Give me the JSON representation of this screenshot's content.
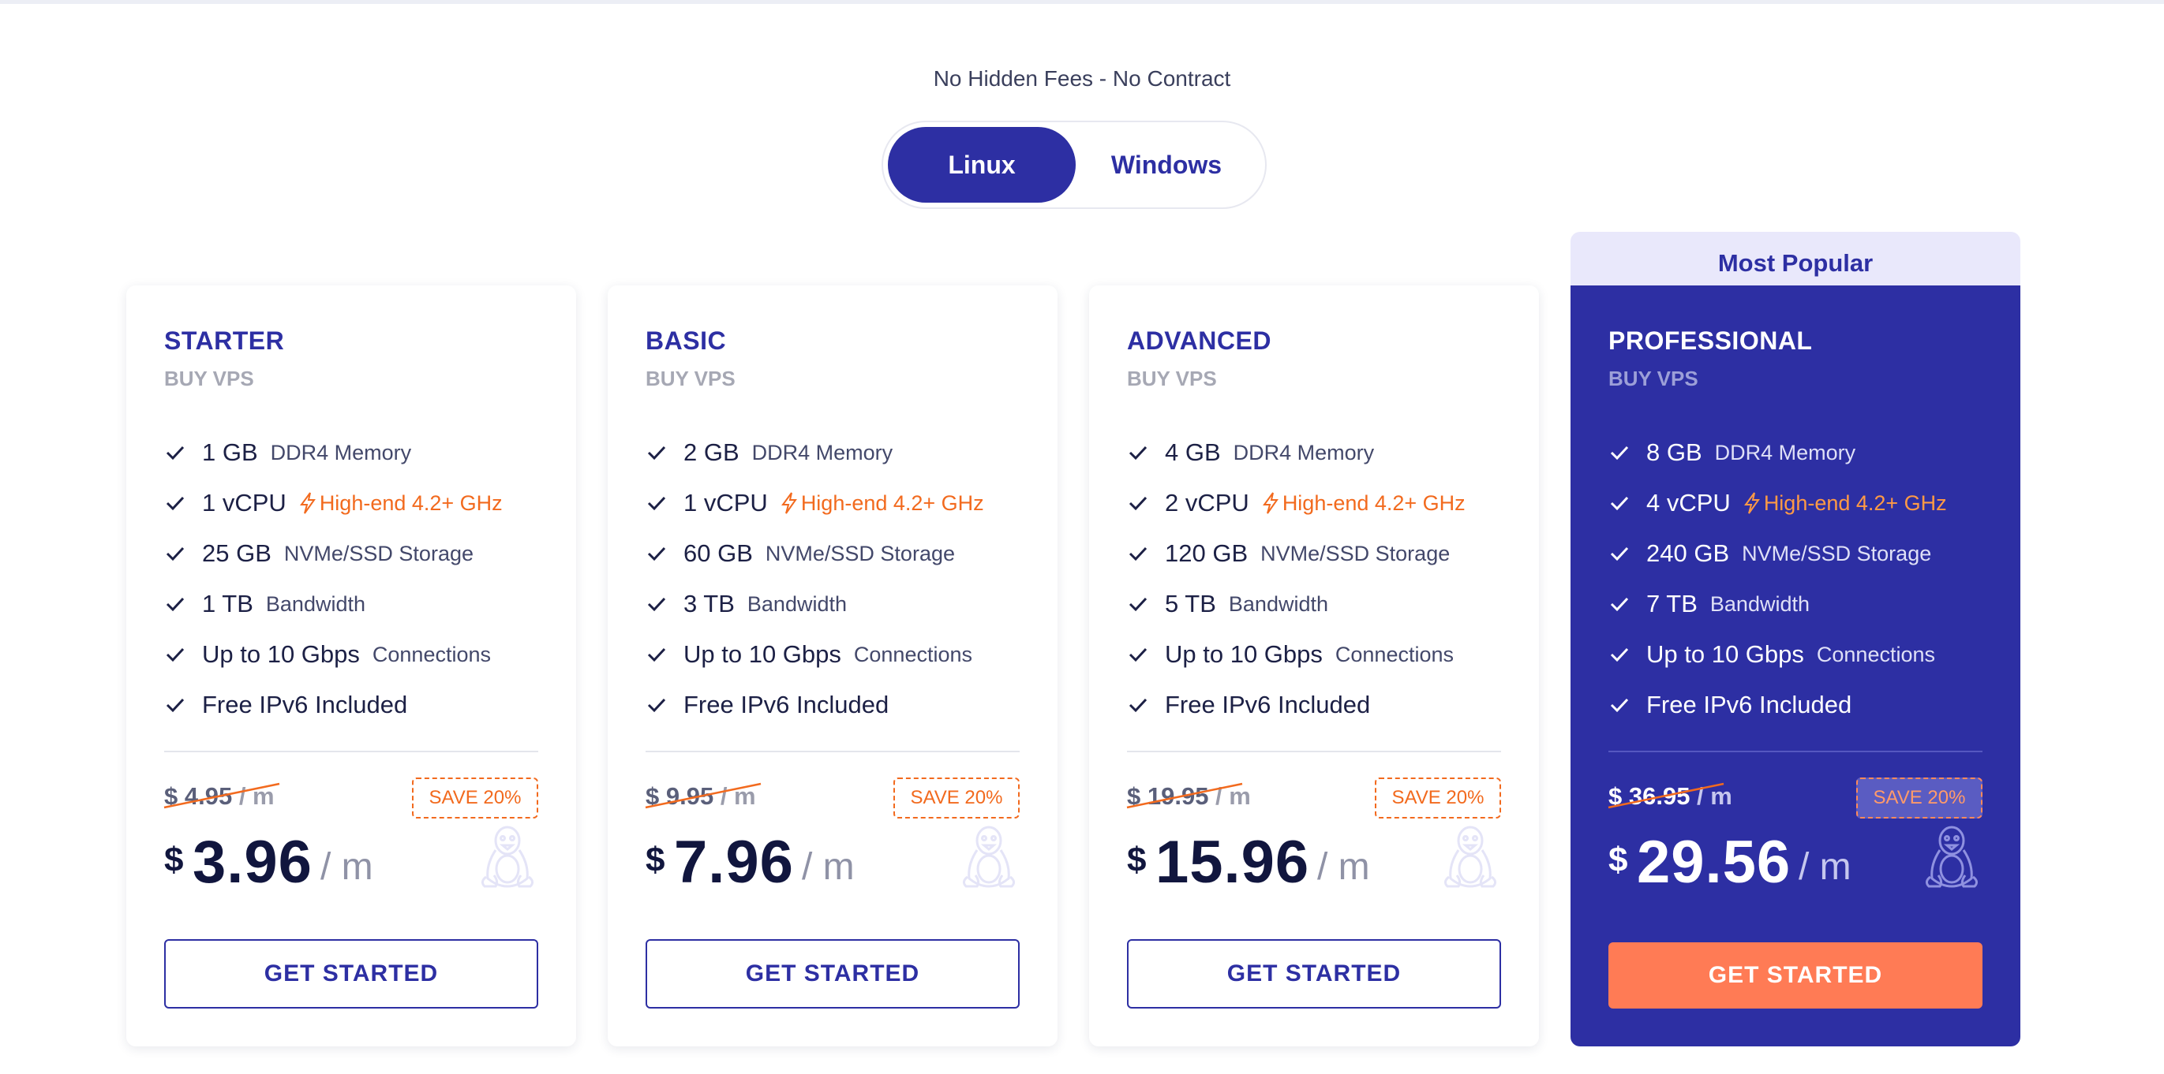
{
  "header": {
    "tagline": "No Hidden Fees - No Contract",
    "os_toggle": {
      "linux_label": "Linux",
      "windows_label": "Windows",
      "selected": "Linux"
    }
  },
  "badge_most_popular": "Most Popular",
  "colors": {
    "brand": "#2d2fa3",
    "accent": "#f26a1e",
    "cta_orange": "#ff7b55",
    "popular_tab": "#e9e8fb"
  },
  "plans": [
    {
      "name": "STARTER",
      "subtitle": "BUY VPS",
      "features": [
        {
          "main": "1 GB",
          "sub": "DDR4 Memory"
        },
        {
          "main": "1 vCPU",
          "sub": "High-end 4.2+ GHz"
        },
        {
          "main": "25 GB",
          "sub": "NVMe/SSD Storage"
        },
        {
          "main": "1 TB",
          "sub": "Bandwidth"
        },
        {
          "main": "Up to 10 Gbps",
          "sub": "Connections"
        },
        {
          "main": "Free IPv6 Included",
          "sub": ""
        }
      ],
      "old_price": "$ 4.95",
      "old_per": " / m",
      "save": "SAVE 20%",
      "currency": "$",
      "price": "3.96",
      "per": "/ m",
      "cta": "GET STARTED",
      "os_icon": "linux-tux-icon"
    },
    {
      "name": "BASIC",
      "subtitle": "BUY VPS",
      "features": [
        {
          "main": "2 GB",
          "sub": "DDR4 Memory"
        },
        {
          "main": "1 vCPU",
          "sub": "High-end 4.2+ GHz"
        },
        {
          "main": "60 GB",
          "sub": "NVMe/SSD Storage"
        },
        {
          "main": "3 TB",
          "sub": "Bandwidth"
        },
        {
          "main": "Up to 10 Gbps",
          "sub": "Connections"
        },
        {
          "main": "Free IPv6 Included",
          "sub": ""
        }
      ],
      "old_price": "$ 9.95",
      "old_per": " / m",
      "save": "SAVE 20%",
      "currency": "$",
      "price": "7.96",
      "per": "/ m",
      "cta": "GET STARTED",
      "os_icon": "linux-tux-icon"
    },
    {
      "name": "ADVANCED",
      "subtitle": "BUY VPS",
      "features": [
        {
          "main": "4 GB",
          "sub": "DDR4 Memory"
        },
        {
          "main": "2 vCPU",
          "sub": "High-end 4.2+ GHz"
        },
        {
          "main": "120 GB",
          "sub": "NVMe/SSD Storage"
        },
        {
          "main": "5 TB",
          "sub": "Bandwidth"
        },
        {
          "main": "Up to 10 Gbps",
          "sub": "Connections"
        },
        {
          "main": "Free IPv6 Included",
          "sub": ""
        }
      ],
      "old_price": "$ 19.95",
      "old_per": " / m",
      "save": "SAVE 20%",
      "currency": "$",
      "price": "15.96",
      "per": "/ m",
      "cta": "GET STARTED",
      "os_icon": "linux-tux-icon"
    },
    {
      "name": "PROFESSIONAL",
      "subtitle": "BUY VPS",
      "features": [
        {
          "main": "8 GB",
          "sub": "DDR4 Memory"
        },
        {
          "main": "4 vCPU",
          "sub": "High-end 4.2+ GHz"
        },
        {
          "main": "240 GB",
          "sub": "NVMe/SSD Storage"
        },
        {
          "main": "7 TB",
          "sub": "Bandwidth"
        },
        {
          "main": "Up to 10 Gbps",
          "sub": "Connections"
        },
        {
          "main": "Free IPv6 Included",
          "sub": ""
        }
      ],
      "old_price": "$ 36.95",
      "old_per": " / m",
      "save": "SAVE 20%",
      "currency": "$",
      "price": "29.56",
      "per": "/ m",
      "cta": "GET STARTED",
      "os_icon": "linux-tux-icon"
    }
  ]
}
